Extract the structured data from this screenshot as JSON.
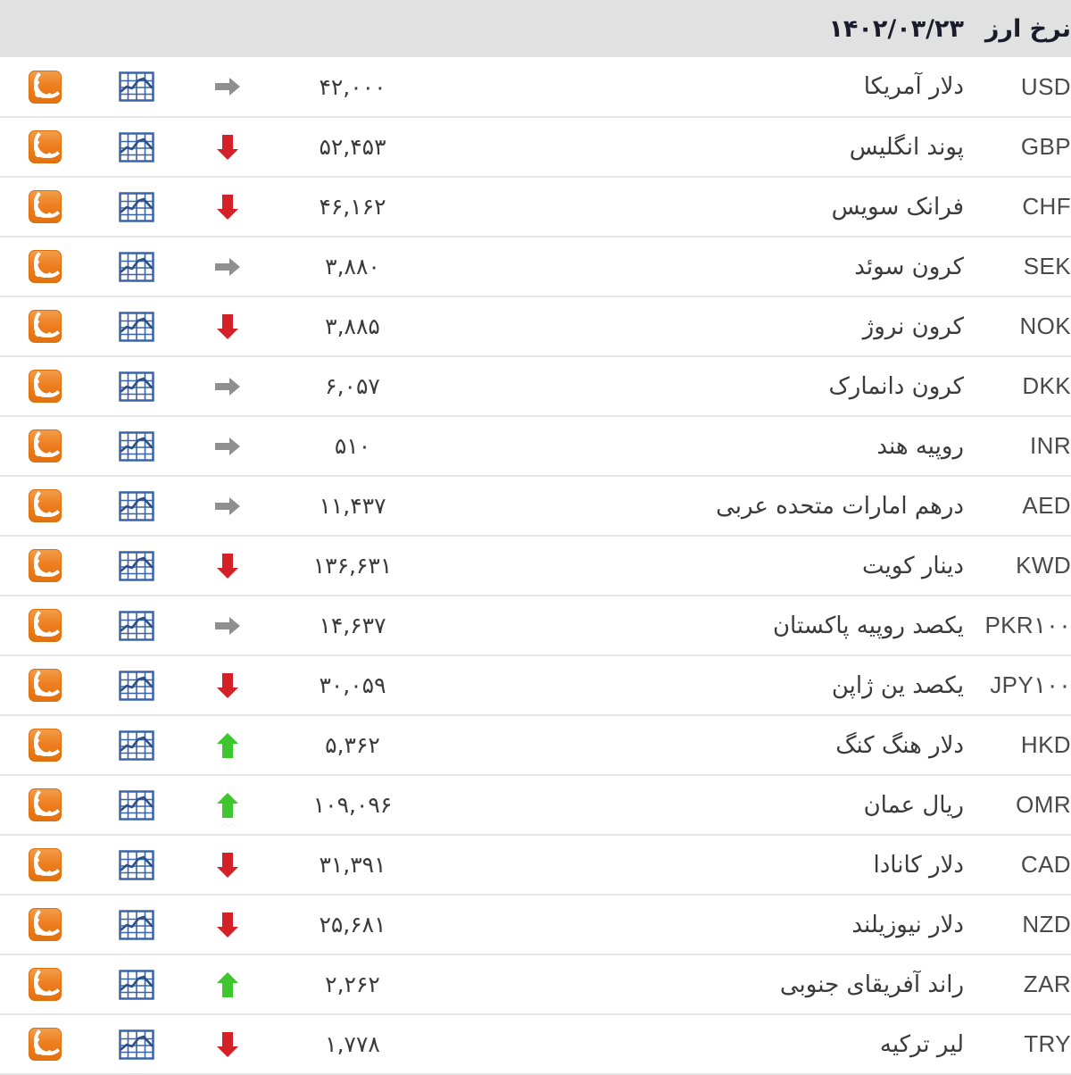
{
  "header": {
    "title": "نرخ ارز",
    "date": "۱۴۰۲/۰۳/۲۳"
  },
  "icons": {
    "rss": "rss-feed-icon",
    "chart": "line-chart-icon",
    "trend_up": "arrow-up-icon",
    "trend_down": "arrow-down-icon",
    "trend_flat": "arrow-right-icon"
  },
  "colors": {
    "header_bg": "#e1e1e1",
    "row_border": "#e6e6e6",
    "text": "#3a3a3a",
    "up": "#3ec62f",
    "down": "#d42027",
    "flat": "#8f8f8f",
    "rss_orange": "#ee7d1e",
    "chart_blue": "#3a63a8"
  },
  "rows": [
    {
      "code": "USD",
      "name": "دلار آمریکا",
      "value": "۴۲,۰۰۰",
      "trend": "flat"
    },
    {
      "code": "GBP",
      "name": "پوند انگلیس",
      "value": "۵۲,۴۵۳",
      "trend": "down"
    },
    {
      "code": "CHF",
      "name": "فرانک سویس",
      "value": "۴۶,۱۶۲",
      "trend": "down"
    },
    {
      "code": "SEK",
      "name": "کرون سوئد",
      "value": "۳,۸۸۰",
      "trend": "flat"
    },
    {
      "code": "NOK",
      "name": "کرون نروژ",
      "value": "۳,۸۸۵",
      "trend": "down"
    },
    {
      "code": "DKK",
      "name": "کرون دانمارک",
      "value": "۶,۰۵۷",
      "trend": "flat"
    },
    {
      "code": "INR",
      "name": "روپیه هند",
      "value": "۵۱۰",
      "trend": "flat"
    },
    {
      "code": "AED",
      "name": "درهم امارات متحده عربی",
      "value": "۱۱,۴۳۷",
      "trend": "flat"
    },
    {
      "code": "KWD",
      "name": "دینار کویت",
      "value": "۱۳۶,۶۳۱",
      "trend": "down"
    },
    {
      "code": "PKR۱۰۰",
      "name": "یکصد روپیه پاکستان",
      "value": "۱۴,۶۳۷",
      "trend": "flat"
    },
    {
      "code": "JPY۱۰۰",
      "name": "یکصد ین ژاپن",
      "value": "۳۰,۰۵۹",
      "trend": "down"
    },
    {
      "code": "HKD",
      "name": "دلار هنگ کنگ",
      "value": "۵,۳۶۲",
      "trend": "up"
    },
    {
      "code": "OMR",
      "name": "ریال عمان",
      "value": "۱۰۹,۰۹۶",
      "trend": "up"
    },
    {
      "code": "CAD",
      "name": "دلار کانادا",
      "value": "۳۱,۳۹۱",
      "trend": "down"
    },
    {
      "code": "NZD",
      "name": "دلار نیوزیلند",
      "value": "۲۵,۶۸۱",
      "trend": "down"
    },
    {
      "code": "ZAR",
      "name": "راند آفریقای جنوبی",
      "value": "۲,۲۶۲",
      "trend": "up"
    },
    {
      "code": "TRY",
      "name": "لیر ترکیه",
      "value": "۱,۷۷۸",
      "trend": "down"
    }
  ]
}
